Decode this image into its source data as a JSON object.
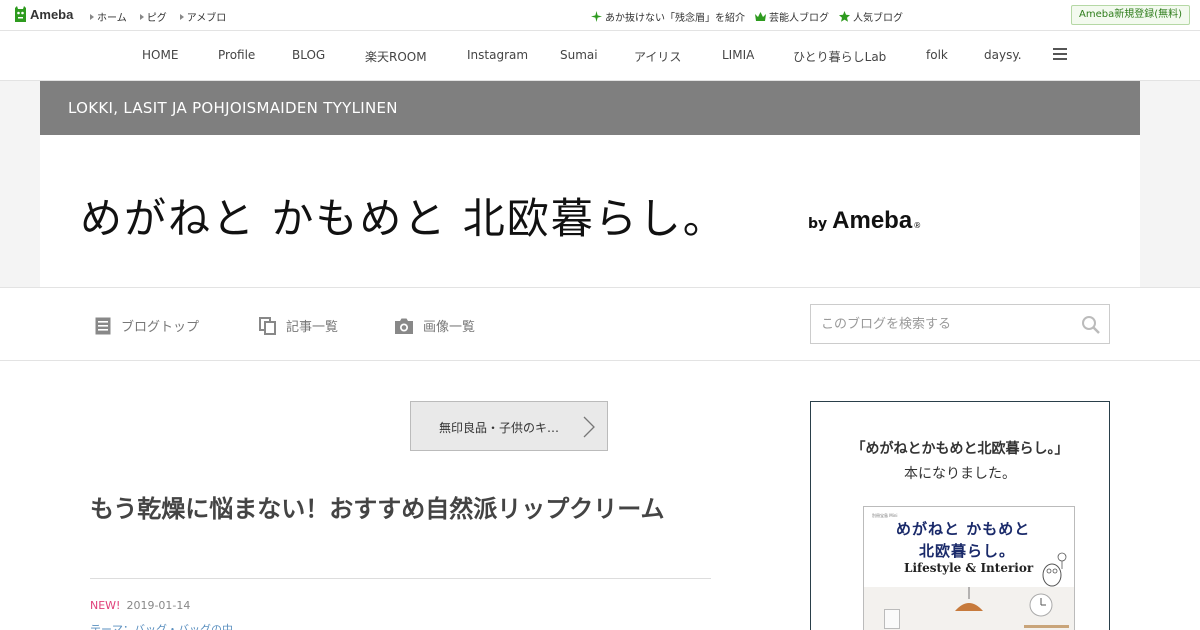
{
  "topbar": {
    "logo_text": "Ameba",
    "links": [
      "ホーム",
      "ピグ",
      "アメブロ"
    ],
    "right_links": [
      {
        "icon": "sparkle-icon",
        "label": "あか抜けない「残念眉」を紹介"
      },
      {
        "icon": "crown-icon",
        "label": "芸能人ブログ"
      },
      {
        "icon": "star-icon",
        "label": "人気ブログ"
      }
    ],
    "signup_label": "Ameba新規登録(無料)",
    "accent_color": "#2e9b1f"
  },
  "main_nav": {
    "items": [
      "HOME",
      "Profile",
      "BLOG",
      "楽天ROOM",
      "Instagram",
      "Sumai",
      "アイリス",
      "LIMIA",
      "ひとり暮らしLab",
      "folk",
      "daysy."
    ],
    "menu_icon": "hamburger-menu-icon"
  },
  "header": {
    "subtitle": "LOKKI, LASIT JA POHJOISMAIDEN TYYLINEN",
    "title": "めがねと かもめと 北欧暮らし。",
    "by_label": "by",
    "brand": "Ameba",
    "reg_mark": "®",
    "strip_color": "#7f7f7f"
  },
  "sub_nav": {
    "items": [
      {
        "icon": "document-icon",
        "label": "ブログトップ"
      },
      {
        "icon": "copy-icon",
        "label": "記事一覧"
      },
      {
        "icon": "camera-icon",
        "label": "画像一覧"
      }
    ],
    "search_placeholder": "このブログを検索する"
  },
  "article": {
    "prev_label": "無印良品・子供のキ…",
    "title": "もう乾燥に悩まない！おすすめ自然派リップクリーム",
    "new_badge": "NEW!",
    "date": "2019-01-14",
    "theme": "テーマ：バッグ・バッグの中"
  },
  "sidebar": {
    "line1": "「めがねとかもめと北欧暮らし。」",
    "line2": "本になりました。",
    "book": {
      "small_text": "別冊宝島 Mini",
      "title_line1": "めがねと かもめと",
      "title_line2": "北欧暮らし。",
      "title_line3": "Lifestyle & Interior"
    }
  }
}
